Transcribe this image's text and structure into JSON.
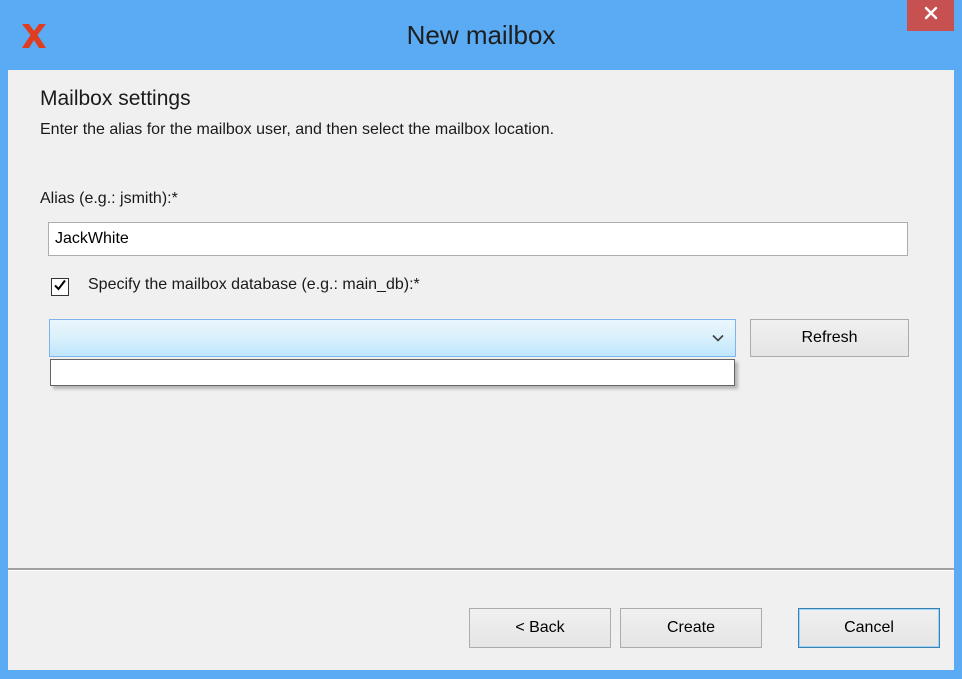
{
  "window": {
    "title": "New mailbox",
    "app_icon": "red-x-logo-icon",
    "close_icon": "close-icon"
  },
  "header": {
    "section_title": "Mailbox settings",
    "description": "Enter the alias for the mailbox user, and then select the mailbox location."
  },
  "form": {
    "alias_label": "Alias (e.g.: jsmith):*",
    "alias_value": "JackWhite",
    "database_checkbox_label": "Specify the mailbox database (e.g.: main_db):*",
    "database_checkbox_checked": true,
    "database_value": "",
    "refresh_label": "Refresh"
  },
  "footer": {
    "back_label": "< Back",
    "create_label": "Create",
    "cancel_label": "Cancel"
  },
  "colors": {
    "title_bar": "#5aabf4",
    "close_button": "#c75050",
    "logo": "#e03c1f",
    "client_bg": "#f0f0f0"
  }
}
